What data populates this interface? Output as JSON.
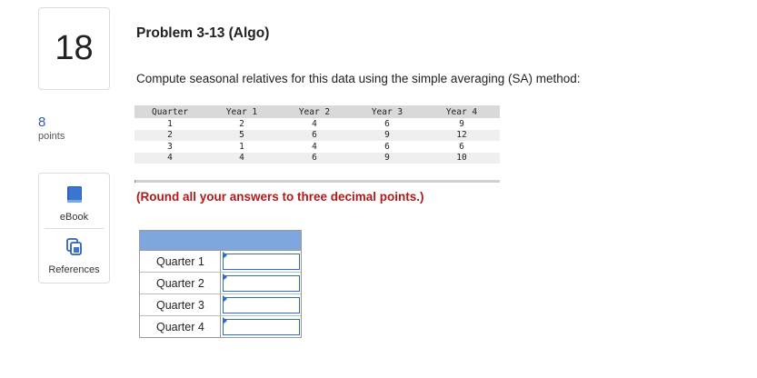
{
  "question": {
    "number": "18",
    "points_value": "8",
    "points_label": "points"
  },
  "resources": [
    {
      "label": "eBook",
      "icon": "book-icon"
    },
    {
      "label": "References",
      "icon": "references-icon"
    }
  ],
  "problem": {
    "title": "Problem 3-13 (Algo)",
    "instruction": "Compute seasonal relatives for this data using the simple averaging (SA) method:",
    "rounding_note": "(Round all your answers to three decimal points.)"
  },
  "data_table": {
    "headers": [
      "Quarter",
      "Year 1",
      "Year 2",
      "Year 3",
      "Year 4"
    ],
    "rows": [
      [
        "1",
        "2",
        "4",
        "6",
        "9"
      ],
      [
        "2",
        "5",
        "6",
        "9",
        "12"
      ],
      [
        "3",
        "1",
        "4",
        "6",
        "6"
      ],
      [
        "4",
        "4",
        "6",
        "9",
        "10"
      ]
    ]
  },
  "answer_table": {
    "header": "",
    "rows": [
      {
        "label": "Quarter 1",
        "value": ""
      },
      {
        "label": "Quarter 2",
        "value": ""
      },
      {
        "label": "Quarter 3",
        "value": ""
      },
      {
        "label": "Quarter 4",
        "value": ""
      }
    ]
  },
  "colors": {
    "accent": "#2d6bd1",
    "header_blue": "#7ea7e0",
    "warning_red": "#b21a1a",
    "points_blue": "#2f5fa8"
  }
}
